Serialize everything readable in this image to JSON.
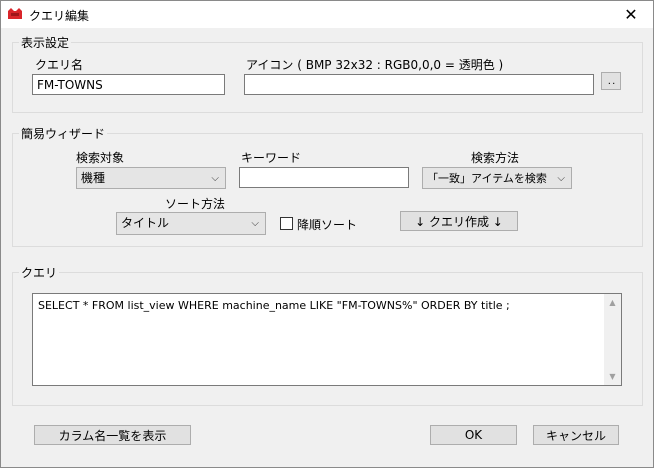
{
  "window": {
    "title": "クエリ編集",
    "close_glyph": "✕"
  },
  "display_settings": {
    "group_label": "表示設定",
    "query_name_label": "クエリ名",
    "query_name_value": "FM-TOWNS",
    "icon_label": "アイコン ( BMP 32x32 : RGB0,0,0 = 透明色 )",
    "icon_value": "",
    "browse_label": ". ."
  },
  "wizard": {
    "group_label": "簡易ウィザード",
    "search_target_label": "検索対象",
    "search_target_value": "機種",
    "keyword_label": "キーワード",
    "keyword_value": "",
    "search_method_label": "検索方法",
    "search_method_value": "「一致」アイテムを検索",
    "sort_method_label": "ソート方法",
    "sort_method_value": "タイトル",
    "descending_label": "降順ソート",
    "descending_checked": false,
    "create_query_label": "↓ クエリ作成 ↓"
  },
  "query": {
    "group_label": "クエリ",
    "sql": "SELECT * FROM list_view WHERE machine_name LIKE \"FM-TOWNS%\" ORDER BY title ;"
  },
  "footer": {
    "show_columns_label": "カラム名一覧を表示",
    "ok_label": "OK",
    "cancel_label": "キャンセル"
  },
  "colors": {
    "app_icon": "#d9252a",
    "background": "#f0f0f0"
  }
}
